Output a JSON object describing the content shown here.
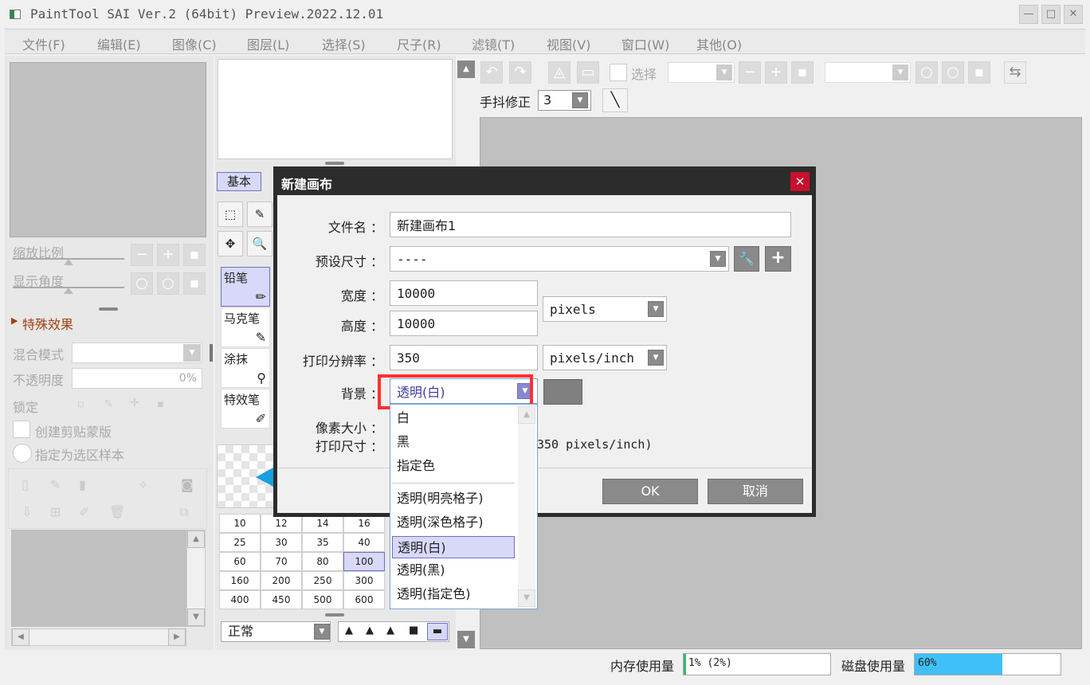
{
  "window": {
    "title": "PaintTool SAI Ver.2 (64bit) Preview.2022.12.01"
  },
  "menu": [
    "文件(F)",
    "编辑(E)",
    "图像(C)",
    "图层(L)",
    "选择(S)",
    "尺子(R)",
    "滤镜(T)",
    "视图(V)",
    "窗口(W)",
    "其他(O)"
  ],
  "navigator": {
    "zoom_label": "缩放比例",
    "angle_label": "显示角度"
  },
  "effects": {
    "title": "特殊效果"
  },
  "layer_props": {
    "blend_label": "混合模式",
    "opacity_label": "不透明度",
    "opacity_value": "0%",
    "lock_label": "锁定",
    "clipping_label": "创建剪贴蒙版",
    "selection_sample_label": "指定为选区样本"
  },
  "tools": {
    "tab_basic": "基本",
    "brushes": [
      "铅笔",
      "马克笔",
      "涂抹",
      "特效笔"
    ],
    "sizes": [
      "10",
      "12",
      "14",
      "16",
      "25",
      "30",
      "35",
      "40",
      "60",
      "70",
      "80",
      "100",
      "160",
      "200",
      "250",
      "300",
      "400",
      "450",
      "500",
      "600"
    ],
    "selected_size": "100",
    "blend_mode": "正常"
  },
  "toolbar": {
    "select_label": "选择",
    "stabilizer_label": "手抖修正",
    "stabilizer_value": "3"
  },
  "dialog": {
    "title": "新建画布",
    "filename_label": "文件名 ：",
    "filename_value": "新建画布1",
    "preset_label": "预设尺寸 ：",
    "preset_value": "----",
    "width_label": "宽度 ：",
    "width_value": "10000",
    "height_label": "高度 ：",
    "height_value": "10000",
    "unit_value": "pixels",
    "resolution_label": "打印分辨率 ：",
    "resolution_value": "350",
    "resolution_unit": "pixels/inch",
    "background_label": "背景 ：",
    "background_value": "透明(白)",
    "pixel_size_label": "像素大小 ：",
    "print_size_label": "打印尺寸 ：",
    "print_size_suffix": "350 pixels/inch)",
    "ok_label": "OK",
    "cancel_label": "取消",
    "accent_color": "#ff3030"
  },
  "background_options": [
    "白",
    "黑",
    "指定色",
    "透明(明亮格子)",
    "透明(深色格子)",
    "透明(白)",
    "透明(黑)",
    "透明(指定色)"
  ],
  "status": {
    "memory_label": "内存使用量",
    "memory_value": "1% (2%)",
    "disk_label": "磁盘使用量",
    "disk_value": "60%",
    "disk_fill": 0.6
  }
}
